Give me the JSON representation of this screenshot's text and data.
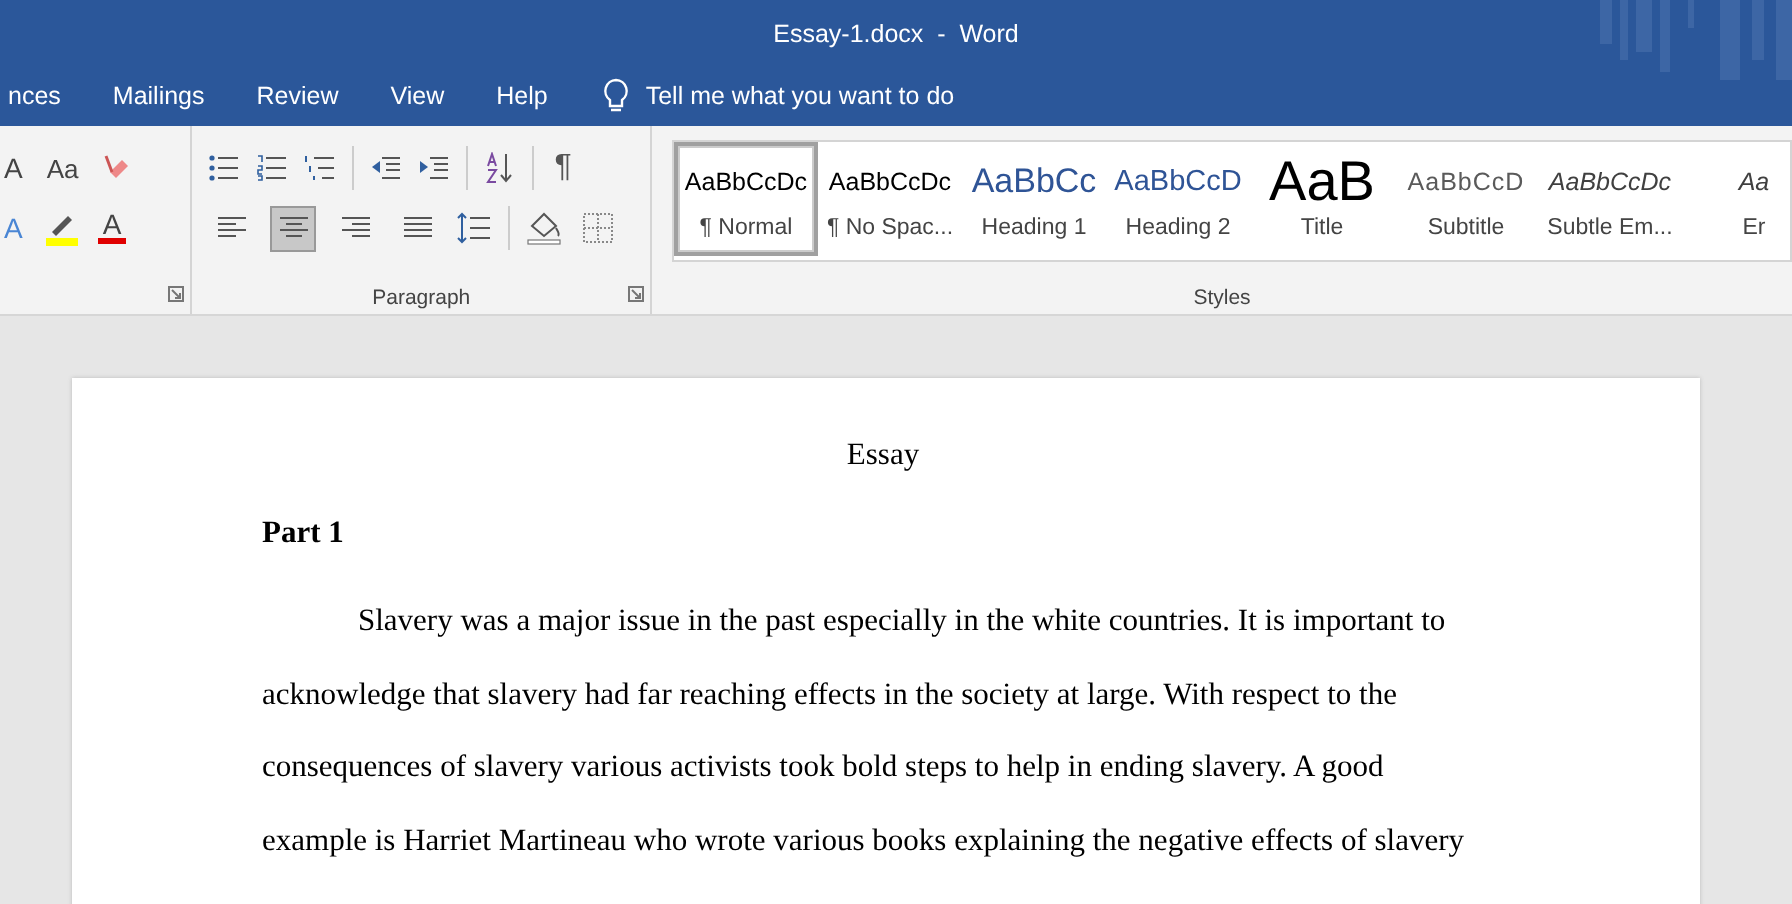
{
  "window": {
    "title": "Essay-1.docx  -  Word"
  },
  "ribbon_tabs": [
    {
      "label": "nces",
      "selected": false
    },
    {
      "label": "Mailings",
      "selected": false
    },
    {
      "label": "Review",
      "selected": false
    },
    {
      "label": "View",
      "selected": false
    },
    {
      "label": "Help",
      "selected": false
    }
  ],
  "tell_me": {
    "placeholder": "Tell me what you want to do"
  },
  "font_group": {
    "row1": [
      {
        "kind": "grow",
        "text": "A"
      },
      {
        "kind": "case",
        "text": "Aa"
      },
      {
        "kind": "clear"
      }
    ],
    "row2": [
      {
        "kind": "effects",
        "text": "A"
      },
      {
        "kind": "highlight"
      },
      {
        "kind": "color",
        "text": "A"
      }
    ]
  },
  "paragraph_group": {
    "label": "Paragraph",
    "row1": [
      {
        "kind": "bullets"
      },
      {
        "kind": "numbering"
      },
      {
        "kind": "multilevel"
      },
      {
        "kind": "sep"
      },
      {
        "kind": "outdent"
      },
      {
        "kind": "indent"
      },
      {
        "kind": "sep"
      },
      {
        "kind": "sort"
      },
      {
        "kind": "sep"
      },
      {
        "kind": "marks",
        "text": "¶"
      }
    ],
    "align": [
      {
        "kind": "left",
        "selected": false
      },
      {
        "kind": "center",
        "selected": true
      },
      {
        "kind": "right",
        "selected": false
      },
      {
        "kind": "justify",
        "selected": false
      }
    ],
    "row2": [
      {
        "kind": "spacing"
      },
      {
        "kind": "sep"
      },
      {
        "kind": "shading"
      },
      {
        "kind": "borders"
      }
    ]
  },
  "styles_group": {
    "label": "Styles",
    "items": [
      {
        "kind": "normal",
        "preview": "AaBbCcDc",
        "label": "¶ Normal",
        "selected": true
      },
      {
        "kind": "normal",
        "preview": "AaBbCcDc",
        "label": "¶ No Spac...",
        "selected": false
      },
      {
        "kind": "heading1",
        "preview": "AaBbCc",
        "label": "Heading 1",
        "selected": false
      },
      {
        "kind": "heading2",
        "preview": "AaBbCcD",
        "label": "Heading 2",
        "selected": false
      },
      {
        "kind": "title",
        "preview": "AaB",
        "label": "Title",
        "selected": false
      },
      {
        "kind": "subtitle",
        "preview": "AaBbCcD",
        "label": "Subtitle",
        "selected": false
      },
      {
        "kind": "emphasis",
        "preview": "AaBbCcDc",
        "label": "Subtle Em...",
        "selected": false
      },
      {
        "kind": "emphasis",
        "preview": "Aa",
        "label": "Er",
        "selected": false
      }
    ]
  },
  "document": {
    "title": "Essay",
    "heading": "Part 1",
    "paragraph": "Slavery was a major issue in the past especially in the white countries. It is important to acknowledge that slavery had far reaching effects in the society at large. With respect to the consequences of slavery various activists took bold steps to help in ending slavery. A good example is Harriet Martineau who wrote various books explaining the negative effects of slavery"
  }
}
